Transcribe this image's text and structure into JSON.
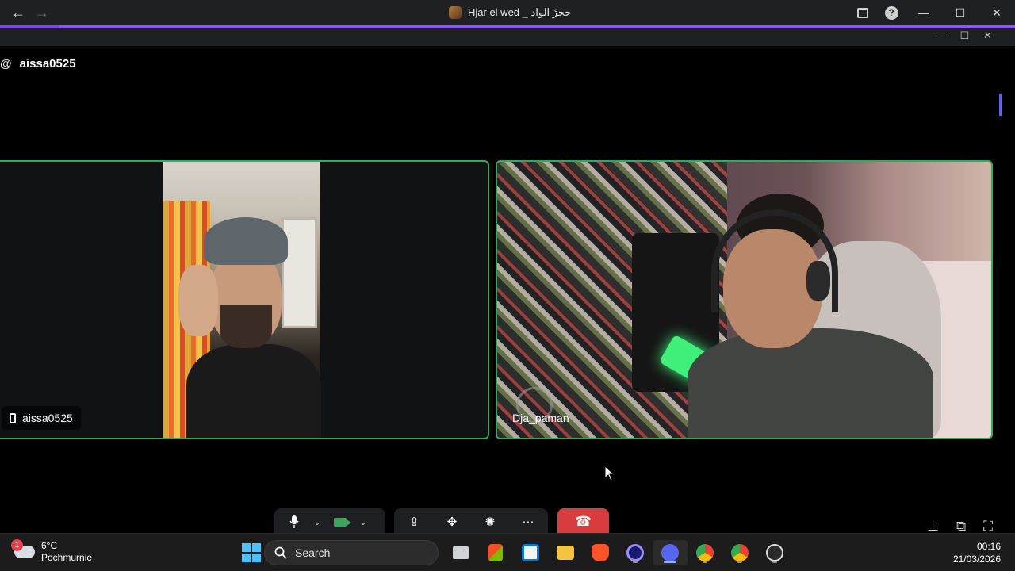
{
  "titlebar": {
    "back_icon": "←",
    "forward_icon": "→",
    "title": "Hjar el wed _ حجرْ الواد"
  },
  "call": {
    "header_user": "aissa0525",
    "participants": [
      {
        "name": "aissa0525",
        "device": "mobile"
      },
      {
        "name": "Dja_paman",
        "device": "desktop"
      }
    ]
  },
  "controls": {
    "mic_icon": "🎙",
    "chevron": "⌄",
    "share_icon": "⇪",
    "activity_icon": "✥",
    "soundboard_icon": "✺",
    "more_icon": "⋯",
    "hangup_icon": "☎",
    "pin_icon": "⊥",
    "popout_icon": "⧉",
    "fullscreen_icon": "⛶"
  },
  "taskbar": {
    "weather_temp": "6°C",
    "weather_desc": "Pochmurnie",
    "weather_badge": "1",
    "search_placeholder": "Search",
    "time": "00:16",
    "date": "21/03/2026"
  },
  "colors": {
    "speaking_border": "#3ba55c",
    "accent": "#7b47e8",
    "hangup": "#d83c3e"
  }
}
